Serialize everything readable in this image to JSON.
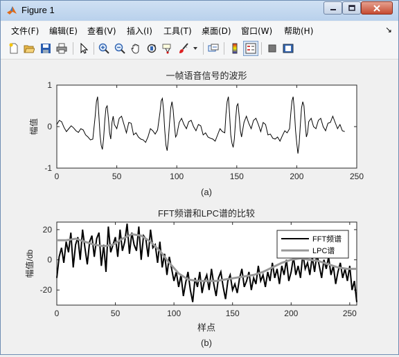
{
  "window": {
    "title": "Figure 1",
    "controls": {
      "minimize": "minimize",
      "maximize": "maximize",
      "close": "close"
    }
  },
  "menu": {
    "items": [
      "文件(F)",
      "编辑(E)",
      "查看(V)",
      "插入(I)",
      "工具(T)",
      "桌面(D)",
      "窗口(W)",
      "帮助(H)"
    ],
    "dock_arrow": "↘"
  },
  "toolbar": {
    "icons": [
      "new-figure-icon",
      "open-file-icon",
      "save-icon",
      "print-icon",
      "select-arrow-icon",
      "zoom-in-icon",
      "zoom-out-icon",
      "pan-hand-icon",
      "rotate-3d-icon",
      "data-cursor-icon",
      "brush-icon",
      "brush-dropdown-icon",
      "link-plot-icon",
      "colorbar-icon",
      "legend-icon",
      "hide-plot-tools-icon",
      "show-plot-tools-icon"
    ]
  },
  "chart_data": [
    {
      "type": "line",
      "title": "一帧语音信号的波形",
      "xlabel": "",
      "ylabel": "幅值",
      "caption": "(a)",
      "xlim": [
        0,
        250
      ],
      "ylim": [
        -1,
        1
      ],
      "xticks": [
        "0",
        "50",
        "100",
        "150",
        "200",
        "250"
      ],
      "yticks": [
        "1",
        "0",
        "-1"
      ],
      "series": [
        {
          "color": "#000000",
          "x": [
            0,
            2,
            4,
            6,
            8,
            10,
            12,
            14,
            16,
            18,
            20,
            22,
            24,
            26,
            28,
            30,
            32,
            33,
            34,
            35,
            36,
            37,
            38,
            39,
            40,
            41,
            42,
            43,
            44,
            45,
            46,
            47,
            48,
            50,
            52,
            54,
            56,
            58,
            60,
            62,
            64,
            66,
            68,
            70,
            72,
            74,
            76,
            78,
            80,
            82,
            84,
            86,
            87,
            88,
            89,
            90,
            91,
            92,
            93,
            94,
            95,
            96,
            97,
            98,
            99,
            100,
            102,
            104,
            106,
            108,
            110,
            112,
            114,
            116,
            118,
            120,
            122,
            124,
            126,
            128,
            130,
            132,
            134,
            136,
            138,
            140,
            141,
            142,
            143,
            144,
            145,
            146,
            147,
            148,
            149,
            150,
            151,
            152,
            153,
            154,
            156,
            158,
            160,
            162,
            164,
            166,
            168,
            170,
            172,
            174,
            176,
            178,
            180,
            182,
            184,
            186,
            188,
            190,
            192,
            194,
            195,
            196,
            197,
            198,
            199,
            200,
            201,
            202,
            203,
            204,
            205,
            206,
            207,
            208,
            209,
            210,
            212,
            214,
            216,
            218,
            220,
            222,
            224,
            226,
            228,
            230,
            232,
            234,
            236,
            238,
            240
          ],
          "y": [
            0.05,
            0.15,
            0.12,
            -0.02,
            -0.12,
            -0.05,
            0.02,
            -0.03,
            -0.1,
            -0.14,
            -0.05,
            -0.08,
            -0.2,
            -0.25,
            -0.32,
            -0.3,
            0.25,
            0.6,
            0.72,
            0.3,
            -0.2,
            -0.45,
            -0.55,
            -0.3,
            0.15,
            0.45,
            0.5,
            0.2,
            -0.15,
            -0.3,
            0.1,
            0.25,
            0.05,
            -0.05,
            0.2,
            0.25,
            0.05,
            -0.15,
            0.1,
            0.08,
            -0.2,
            -0.15,
            -0.25,
            -0.3,
            -0.32,
            -0.38,
            -0.25,
            -0.05,
            -0.1,
            -0.18,
            -0.08,
            0.35,
            0.62,
            0.68,
            0.4,
            -0.1,
            -0.45,
            -0.58,
            -0.3,
            0.1,
            0.45,
            0.6,
            0.4,
            0.05,
            -0.25,
            -0.2,
            0.1,
            0.2,
            0.05,
            -0.05,
            0.12,
            0.15,
            0.0,
            -0.1,
            0.05,
            0.02,
            -0.2,
            -0.15,
            -0.25,
            -0.28,
            -0.3,
            -0.35,
            -0.2,
            -0.05,
            -0.12,
            -0.15,
            0.3,
            0.6,
            0.72,
            0.3,
            -0.2,
            -0.4,
            -0.5,
            -0.3,
            0.15,
            0.5,
            0.55,
            0.25,
            -0.1,
            -0.25,
            0.1,
            0.25,
            0.08,
            -0.05,
            0.15,
            0.2,
            0.05,
            -0.12,
            0.1,
            0.05,
            -0.2,
            -0.18,
            -0.28,
            -0.3,
            -0.25,
            -0.35,
            -0.22,
            -0.1,
            -0.15,
            -0.05,
            0.3,
            0.62,
            0.72,
            0.4,
            -0.1,
            -0.4,
            -0.65,
            -0.4,
            0.05,
            0.45,
            0.6,
            0.5,
            0.1,
            -0.25,
            -0.15,
            0.12,
            0.2,
            0.0,
            -0.05,
            0.15,
            0.2,
            0.0,
            -0.1,
            0.08,
            0.1,
            0.25,
            0.1,
            -0.05,
            0.05,
            -0.1,
            -0.12
          ]
        }
      ]
    },
    {
      "type": "line",
      "title": "FFT频谱和LPC谱的比较",
      "xlabel": "样点",
      "ylabel": "幅值/db",
      "caption": "(b)",
      "xlim": [
        0,
        256
      ],
      "ylim": [
        -30,
        25
      ],
      "xticks": [
        "0",
        "50",
        "100",
        "150",
        "200",
        "250"
      ],
      "yticks": [
        "20",
        "0",
        "-20"
      ],
      "legend": {
        "position": "top-right"
      },
      "series": [
        {
          "name": "FFT频谱",
          "color": "#000000",
          "x": [
            0,
            2,
            4,
            6,
            8,
            10,
            12,
            14,
            16,
            18,
            20,
            22,
            24,
            26,
            28,
            30,
            32,
            34,
            36,
            38,
            40,
            42,
            44,
            46,
            48,
            50,
            52,
            54,
            56,
            58,
            60,
            62,
            64,
            66,
            68,
            70,
            72,
            74,
            76,
            78,
            80,
            82,
            84,
            86,
            88,
            90,
            92,
            94,
            96,
            98,
            100,
            102,
            104,
            106,
            108,
            110,
            112,
            114,
            116,
            118,
            120,
            122,
            124,
            126,
            128,
            130,
            132,
            134,
            136,
            138,
            140,
            142,
            144,
            146,
            148,
            150,
            152,
            154,
            156,
            158,
            160,
            162,
            164,
            166,
            168,
            170,
            172,
            174,
            176,
            178,
            180,
            182,
            184,
            186,
            188,
            190,
            192,
            194,
            196,
            198,
            200,
            202,
            204,
            206,
            208,
            210,
            212,
            214,
            216,
            218,
            220,
            222,
            224,
            226,
            228,
            230,
            232,
            234,
            236,
            238,
            240,
            242,
            244,
            246,
            248,
            250,
            252,
            254,
            256
          ],
          "y": [
            -12,
            2,
            8,
            -2,
            12,
            5,
            18,
            -5,
            10,
            15,
            0,
            20,
            8,
            -3,
            12,
            16,
            2,
            14,
            18,
            -4,
            10,
            -8,
            22,
            5,
            10,
            15,
            2,
            20,
            6,
            12,
            24,
            4,
            18,
            10,
            6,
            22,
            0,
            16,
            14,
            2,
            20,
            8,
            10,
            -2,
            12,
            -5,
            4,
            -10,
            2,
            -6,
            -14,
            -8,
            -18,
            -10,
            -24,
            -15,
            -8,
            -20,
            -28,
            -12,
            -18,
            -8,
            -22,
            -14,
            -10,
            -20,
            -6,
            -16,
            -24,
            -12,
            -8,
            -18,
            -26,
            -14,
            -10,
            -20,
            -16,
            -22,
            -12,
            -6,
            -18,
            -14,
            -8,
            -20,
            -12,
            -16,
            -4,
            -14,
            -10,
            -18,
            -8,
            -14,
            -2,
            -12,
            -6,
            -16,
            -4,
            -10,
            0,
            -14,
            -8,
            2,
            -10,
            -4,
            -12,
            4,
            -6,
            -2,
            -10,
            2,
            -8,
            4,
            -4,
            -12,
            0,
            -6,
            2,
            -10,
            -4,
            -16,
            -8,
            -2,
            -12,
            -6,
            -14,
            -4,
            -20,
            -14,
            -28
          ]
        },
        {
          "name": "LPC谱",
          "color": "#999999",
          "x": [
            0,
            8,
            16,
            24,
            32,
            40,
            48,
            56,
            64,
            72,
            80,
            88,
            96,
            104,
            112,
            120,
            128,
            136,
            144,
            152,
            160,
            168,
            176,
            184,
            192,
            200,
            208,
            216,
            224,
            232,
            240,
            248,
            256
          ],
          "y": [
            13,
            13,
            14,
            12,
            10,
            9,
            10,
            14,
            17,
            16,
            12,
            6,
            -2,
            -9,
            -13,
            -14,
            -14,
            -14,
            -13,
            -12,
            -11,
            -10,
            -8,
            -5,
            -2,
            0,
            1,
            0,
            -1,
            -3,
            -5,
            -6,
            -6
          ]
        }
      ]
    }
  ]
}
